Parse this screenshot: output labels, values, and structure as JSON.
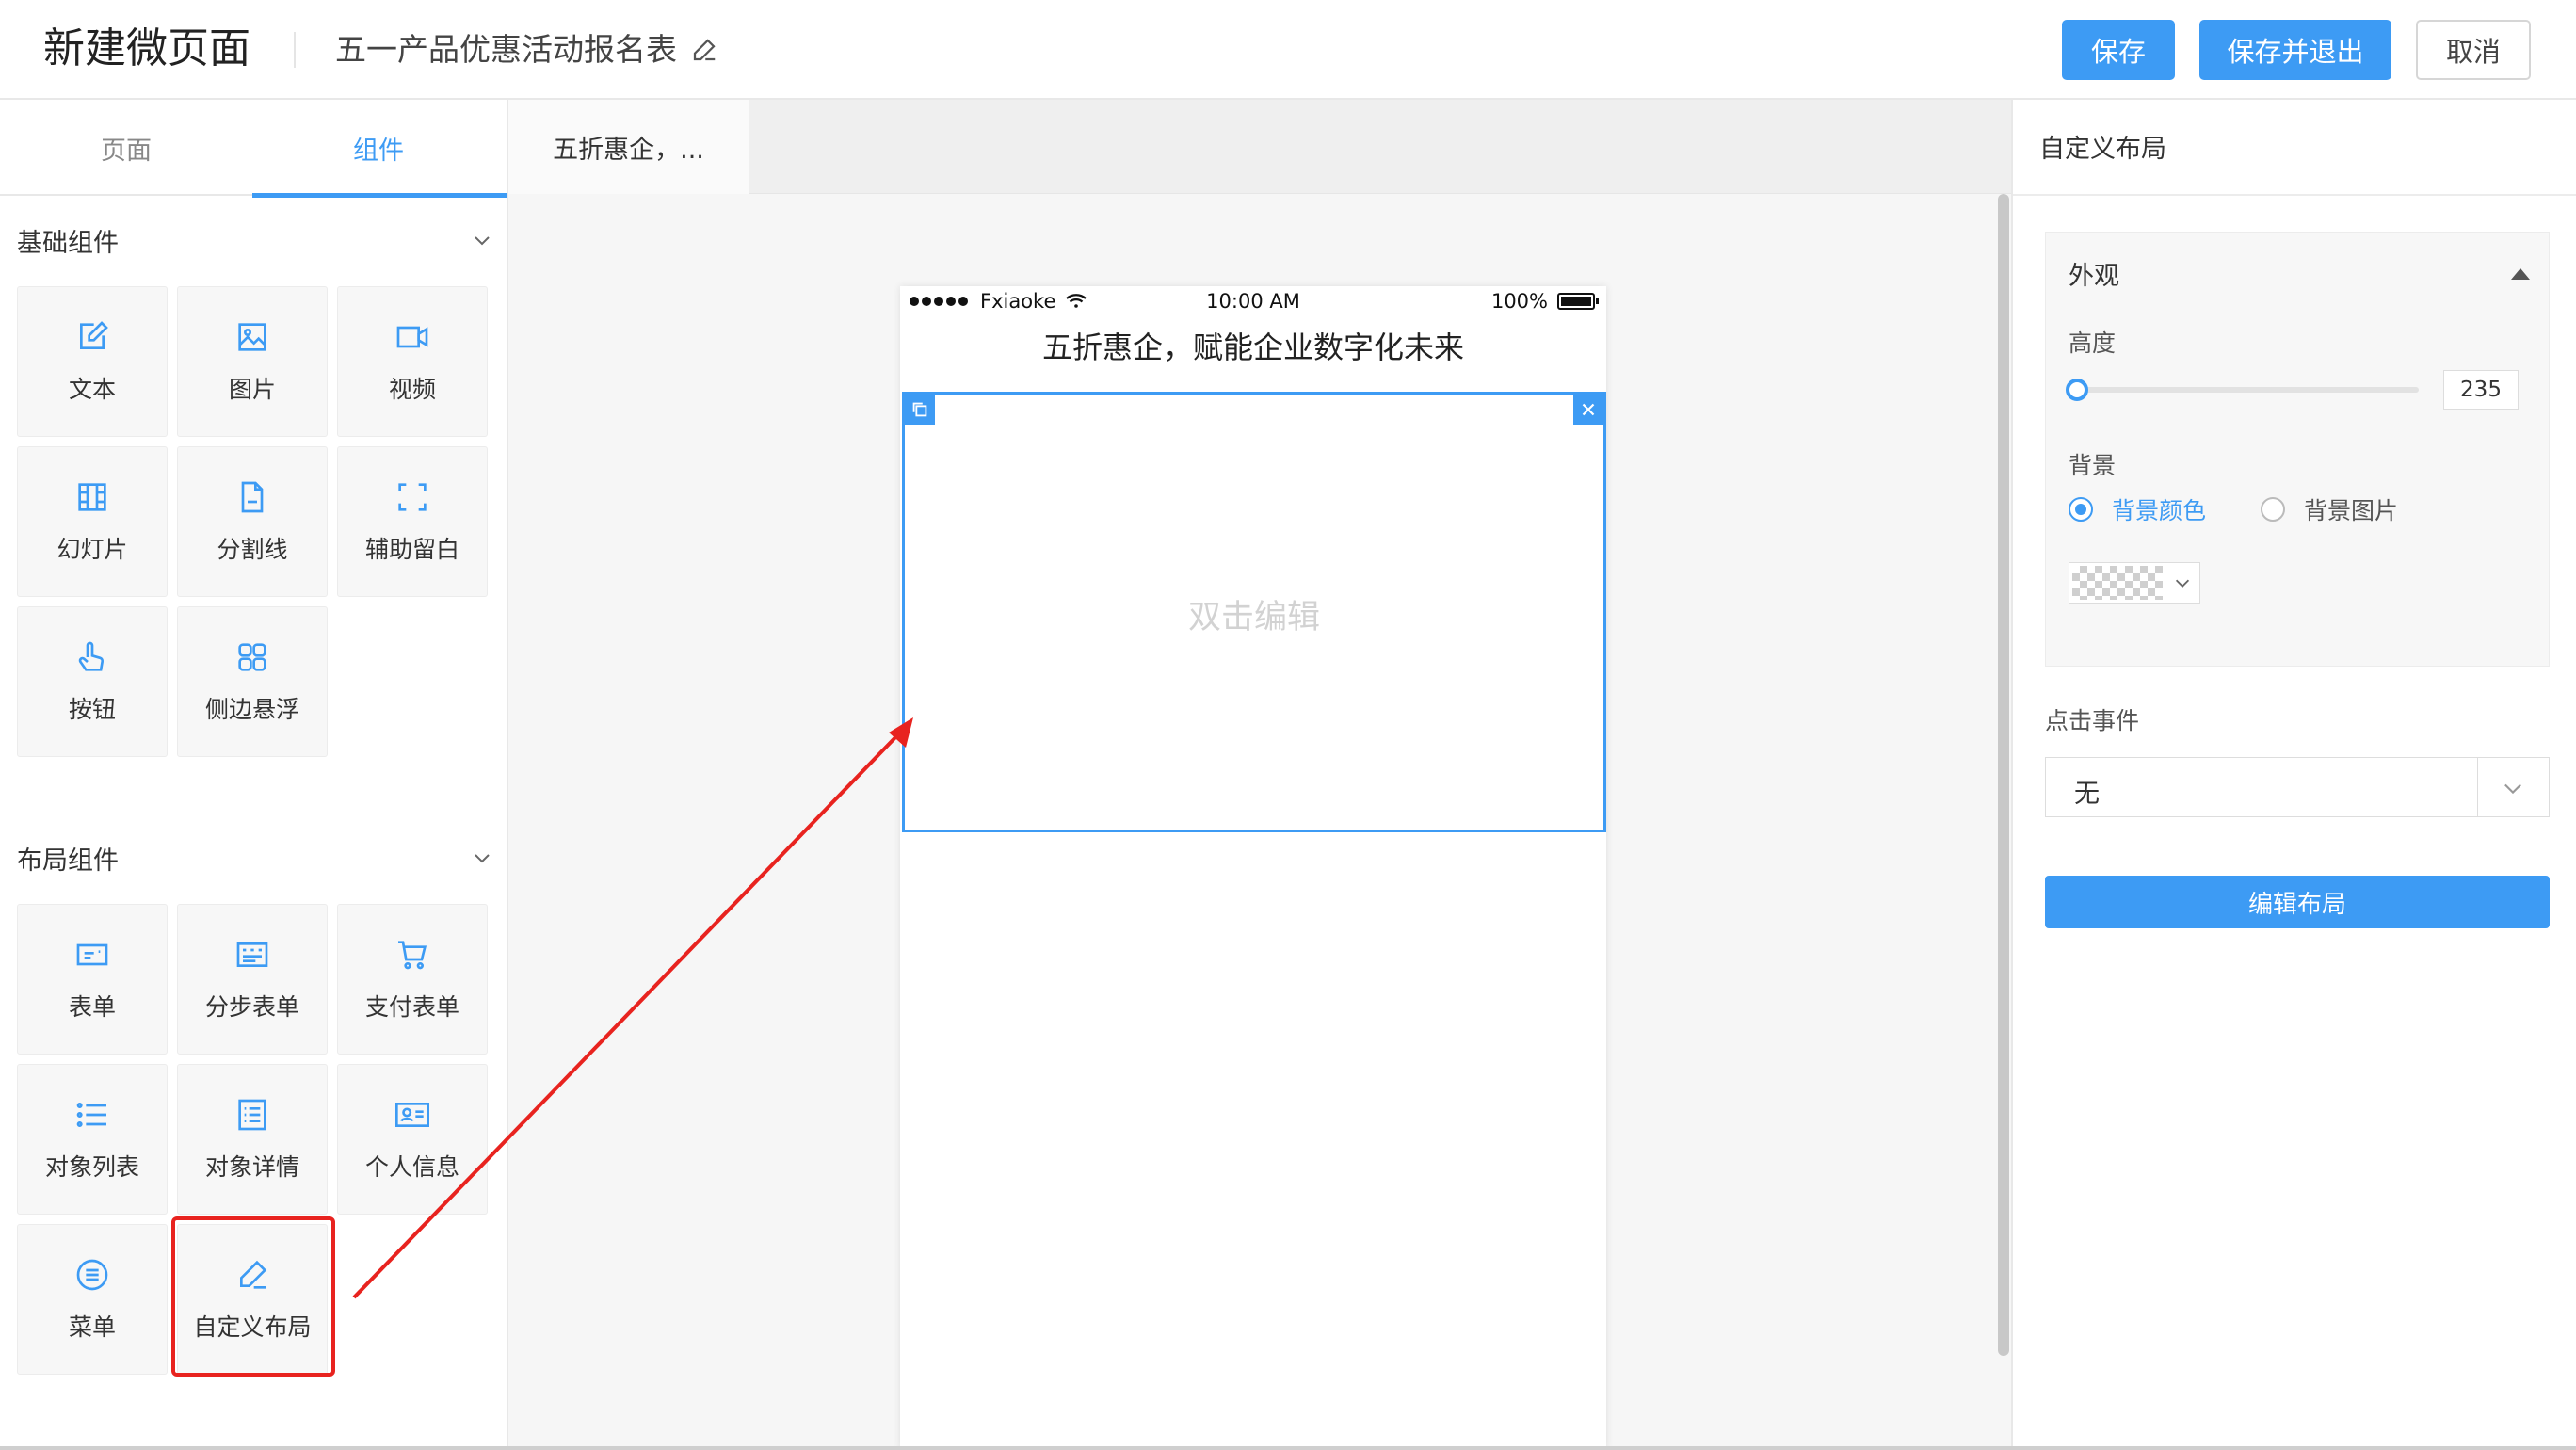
{
  "header": {
    "page_title": "新建微页面",
    "doc_title": "五一产品优惠活动报名表",
    "save_label": "保存",
    "save_exit_label": "保存并退出",
    "cancel_label": "取消"
  },
  "left_panel": {
    "tabs": [
      {
        "label": "页面",
        "active": false
      },
      {
        "label": "组件",
        "active": true
      }
    ],
    "basic_section": {
      "title": "基础组件",
      "items": [
        {
          "label": "文本",
          "icon": "edit-icon"
        },
        {
          "label": "图片",
          "icon": "image-icon"
        },
        {
          "label": "视频",
          "icon": "video-icon"
        },
        {
          "label": "幻灯片",
          "icon": "slideshow-icon"
        },
        {
          "label": "分割线",
          "icon": "divider-doc-icon"
        },
        {
          "label": "辅助留白",
          "icon": "whitespace-icon"
        },
        {
          "label": "按钮",
          "icon": "hand-pointer-icon"
        },
        {
          "label": "侧边悬浮",
          "icon": "grid-apps-icon"
        }
      ]
    },
    "layout_section": {
      "title": "布局组件",
      "items": [
        {
          "label": "表单",
          "icon": "form-icon"
        },
        {
          "label": "分步表单",
          "icon": "step-form-icon"
        },
        {
          "label": "支付表单",
          "icon": "cart-icon"
        },
        {
          "label": "对象列表",
          "icon": "list-icon"
        },
        {
          "label": "对象详情",
          "icon": "detail-icon"
        },
        {
          "label": "个人信息",
          "icon": "profile-card-icon"
        },
        {
          "label": "菜单",
          "icon": "menu-circle-icon"
        },
        {
          "label": "自定义布局",
          "icon": "pen-icon",
          "highlighted": true
        }
      ]
    }
  },
  "canvas": {
    "tab_label": "五折惠企，...",
    "phone": {
      "carrier": "Fxiaoke",
      "time": "10:00 AM",
      "battery": "100%",
      "title": "五折惠企，赋能企业数字化未来",
      "block_hint": "双击编辑"
    }
  },
  "right_panel": {
    "title": "自定义布局",
    "appearance": {
      "title": "外观",
      "height_label": "高度",
      "height_value": "235",
      "height_fraction": 0.02,
      "background_label": "背景",
      "background_options": [
        {
          "label": "背景颜色",
          "selected": true
        },
        {
          "label": "背景图片",
          "selected": false
        }
      ]
    },
    "click_event": {
      "label": "点击事件",
      "value": "无"
    },
    "edit_layout_label": "编辑布局"
  },
  "colors": {
    "accent": "#3d9bf4",
    "highlight": "#e8231f"
  }
}
